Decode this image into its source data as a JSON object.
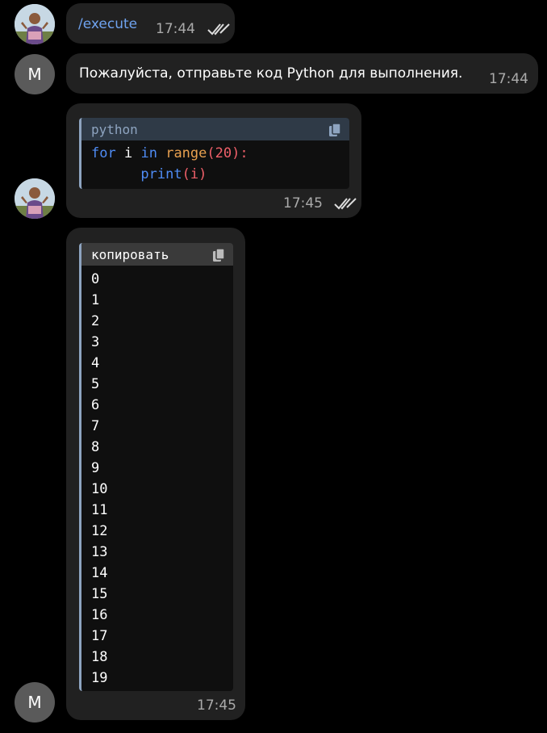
{
  "messages": [
    {
      "id": "m1",
      "sender": "self",
      "text": "/execute",
      "time": "17:44",
      "status": "read"
    },
    {
      "id": "m2",
      "sender": "bot",
      "avatar_letter": "M",
      "text": "Пожалуйста, отправьте код Python для выполнения.",
      "time": "17:44"
    },
    {
      "id": "m3",
      "sender": "self",
      "code": {
        "language": "python",
        "line1": {
          "kw_for": "for",
          "var_i": "i",
          "kw_in": "in",
          "fn_range": "range",
          "open": "(",
          "arg": "20",
          "close": "):"
        },
        "line2": {
          "indent": "      ",
          "fn_print": "print",
          "open": "(",
          "arg": "i",
          "close": ")"
        }
      },
      "time": "17:45",
      "status": "read"
    },
    {
      "id": "m4",
      "sender": "bot",
      "avatar_letter": "M",
      "code": {
        "header": "копировать",
        "lines": [
          "0",
          "1",
          "2",
          "3",
          "4",
          "5",
          "6",
          "7",
          "8",
          "9",
          "10",
          "11",
          "12",
          "13",
          "14",
          "15",
          "16",
          "17",
          "18",
          "19"
        ]
      },
      "time": "17:45"
    }
  ],
  "icons": {
    "copy": "copy-icon",
    "read": "double-check-icon",
    "avatar": "user-photo"
  },
  "colors": {
    "background": "#000000",
    "bubble": "#212121",
    "link": "#6fa3ef",
    "keyword": "#4f8cf5",
    "function": "#e8a04f",
    "number": "#f0606a",
    "time": "#aaaaaa"
  }
}
